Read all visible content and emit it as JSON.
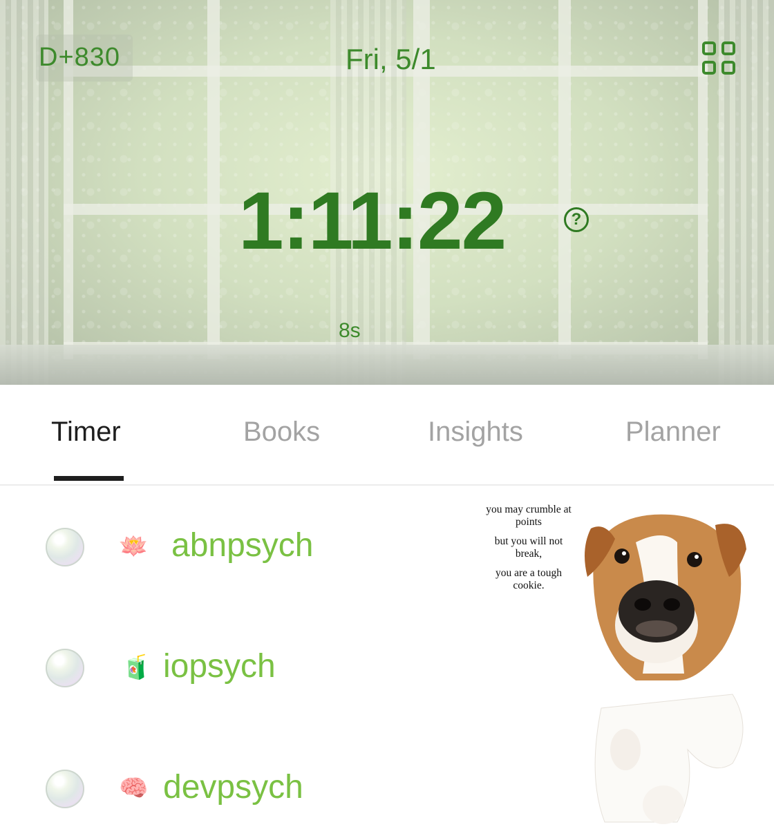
{
  "header": {
    "d_counter": "D+830",
    "date": "Fri, 5/1",
    "timer": "1:11:22",
    "help_symbol": "?",
    "seconds": "8s",
    "accent_color": "#3d8a2c"
  },
  "tabs": [
    {
      "label": "Timer",
      "active": true
    },
    {
      "label": "Books",
      "active": false
    },
    {
      "label": "Insights",
      "active": false
    },
    {
      "label": "Planner",
      "active": false
    }
  ],
  "subjects": [
    {
      "emoji": "🪷",
      "name": "abnpsych"
    },
    {
      "emoji": "🧃",
      "name": "iopsych"
    },
    {
      "emoji": "🧠",
      "name": "devpsych"
    }
  ],
  "sticker": {
    "lines": [
      "you may crumble at points",
      "but you will not break,",
      "you are a tough cookie."
    ]
  },
  "colors": {
    "subject_name": "#7ac143",
    "active_tab": "#1e1e1e",
    "inactive_tab": "#a3a3a3"
  }
}
